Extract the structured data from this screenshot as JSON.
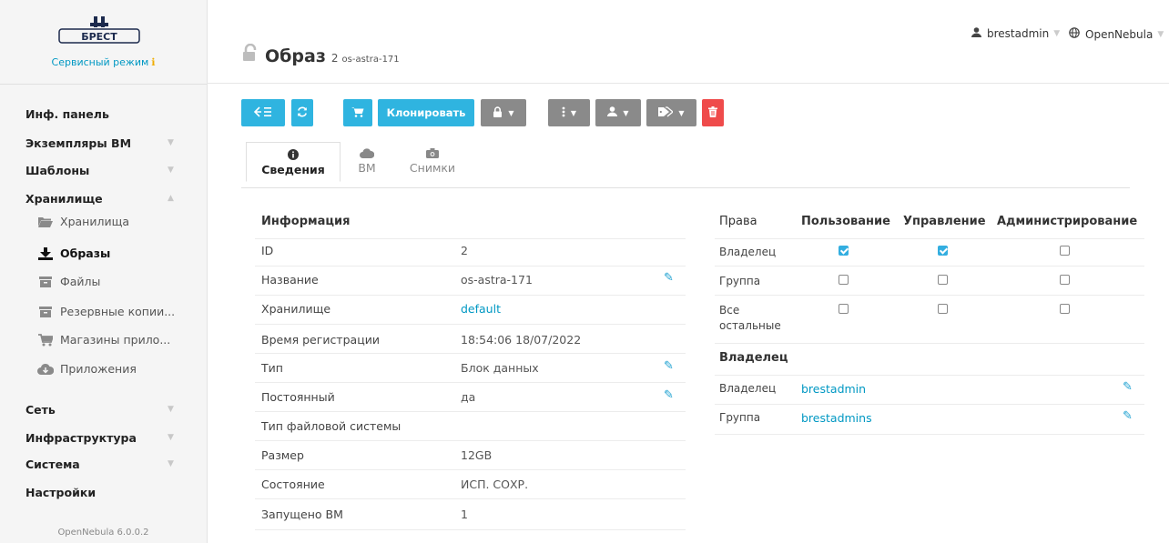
{
  "sidebar": {
    "brand": "БРЕСТ",
    "service_mode": "Сервисный режим",
    "nav": {
      "dashboard": "Инф. панель",
      "vms": "Экземпляры ВМ",
      "templates": "Шаблоны",
      "storage": "Хранилище",
      "storage_sub": {
        "datastores": "Хранилища",
        "images": "Образы",
        "files": "Файлы",
        "backups": "Резервные копии...",
        "marketplaces": "Магазины прило...",
        "apps": "Приложения"
      },
      "network": "Сеть",
      "infrastructure": "Инфраструктура",
      "system": "Система",
      "settings": "Настройки"
    },
    "version": "OpenNebula 6.0.0.2"
  },
  "topbar": {
    "user": "brestadmin",
    "zone": "OpenNebula"
  },
  "header": {
    "title": "Образ",
    "id": "2",
    "name": "os-astra-171"
  },
  "toolbar": {
    "clone_label": "Клонировать"
  },
  "tabs": [
    {
      "label": "Сведения",
      "icon": "info-circle-icon"
    },
    {
      "label": "ВМ",
      "icon": "cloud-icon"
    },
    {
      "label": "Снимки",
      "icon": "camera-icon"
    }
  ],
  "info": {
    "heading": "Информация",
    "rows": [
      {
        "label": "ID",
        "value": "2"
      },
      {
        "label": "Название",
        "value": "os-astra-171"
      },
      {
        "label": "Хранилище",
        "value": "default"
      },
      {
        "label": "Время регистрации",
        "value": "18:54:06 18/07/2022"
      },
      {
        "label": "Тип",
        "value": "Блок данных"
      },
      {
        "label": "Постоянный",
        "value": "да"
      },
      {
        "label": "Тип файловой системы",
        "value": ""
      },
      {
        "label": "Размер",
        "value": "12GB"
      },
      {
        "label": "Состояние",
        "value": "ИСП. СОХР."
      },
      {
        "label": "Запущено ВМ",
        "value": "1"
      }
    ]
  },
  "permissions": {
    "headers": [
      "Права",
      "Пользование",
      "Управление",
      "Администрирование"
    ],
    "rows": [
      {
        "label": "Владелец",
        "use": true,
        "manage": true,
        "admin": false
      },
      {
        "label": "Группа",
        "use": false,
        "manage": false,
        "admin": false
      },
      {
        "label": "Все остальные",
        "use": false,
        "manage": false,
        "admin": false
      }
    ]
  },
  "ownership": {
    "heading": "Владелец",
    "rows": [
      {
        "label": "Владелец",
        "value": "brestadmin"
      },
      {
        "label": "Группа",
        "value": "brestadmins"
      }
    ]
  },
  "colors": {
    "accent": "#2fb4e0",
    "danger": "#ef4b4b",
    "link": "#0098c3"
  }
}
